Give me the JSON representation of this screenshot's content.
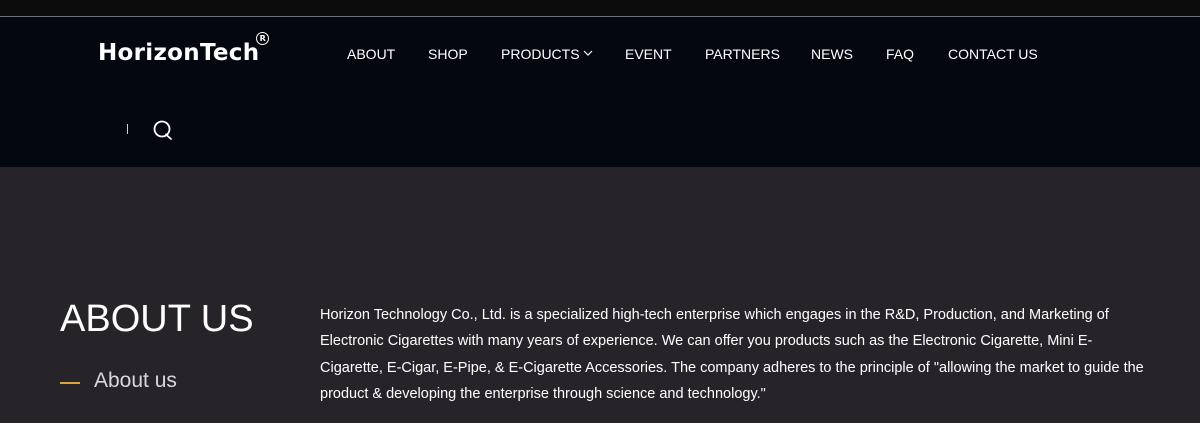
{
  "header": {
    "logo_text": "HorizonTech",
    "logo_reg_mark": "R",
    "nav": [
      {
        "label": "ABOUT"
      },
      {
        "label": "SHOP"
      },
      {
        "label": "PRODUCTS",
        "has_dropdown": true
      },
      {
        "label": "EVENT"
      },
      {
        "label": "PARTNERS"
      },
      {
        "label": "NEWS"
      },
      {
        "label": "FAQ"
      },
      {
        "label": "CONTACT US"
      }
    ],
    "search_icon": "search-icon",
    "divider_text": "I"
  },
  "about": {
    "title": "ABOUT US",
    "subtitle": "About us",
    "body": "Horizon Technology Co., Ltd. is a specialized high-tech enterprise which engages in the R&D, Production, and Marketing of Electronic Cigarettes with many years of experience. We can offer you products such as the Electronic Cigarette, Mini E-Cigarette, E-Cigar, E-Pipe, & E-Cigarette Accessories. The company adheres to the principle of \"allowing the market to guide the product & developing the enterprise through science and technology.\""
  },
  "colors": {
    "header_bg": "#03070f",
    "page_bg": "#262429",
    "accent": "#d9a441"
  }
}
